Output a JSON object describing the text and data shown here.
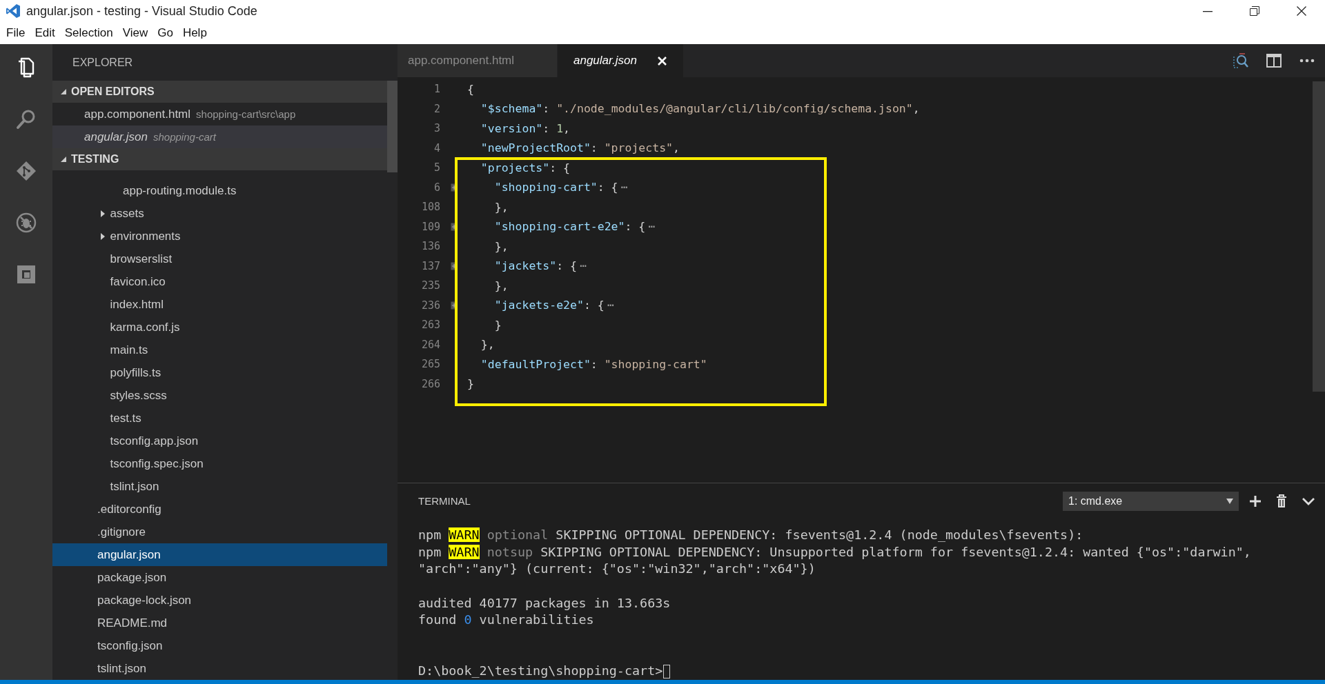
{
  "window": {
    "title": "angular.json - testing - Visual Studio Code"
  },
  "menu": [
    "File",
    "Edit",
    "Selection",
    "View",
    "Go",
    "Help"
  ],
  "activity_bar": [
    {
      "kind": "files",
      "selected": true
    },
    {
      "kind": "search",
      "selected": false
    },
    {
      "kind": "git",
      "selected": false
    },
    {
      "kind": "debug",
      "selected": false
    },
    {
      "kind": "extensions",
      "selected": false
    }
  ],
  "sidebar": {
    "title": "EXPLORER",
    "sections": [
      {
        "title": "OPEN EDITORS",
        "expanded": true,
        "kind": "editors",
        "items": [
          {
            "name": "app.component.html",
            "path": "shopping-cart\\src\\app",
            "selected": false,
            "preview": false
          },
          {
            "name": "angular.json",
            "path": "shopping-cart",
            "selected": true,
            "preview": true
          }
        ]
      },
      {
        "title": "TESTING",
        "expanded": true,
        "kind": "tree",
        "items": [
          {
            "children": [
              {
                "children": [
                  {
                    "label": "app-routing.module.ts",
                    "kind": "file",
                    "selected": false
                  }
                ]
              },
              {
                "label": "assets",
                "kind": "folder",
                "expanded": false,
                "selected": false
              },
              {
                "label": "environments",
                "kind": "folder",
                "expanded": false,
                "selected": false
              },
              {
                "label": "browserslist",
                "kind": "file",
                "selected": false
              },
              {
                "label": "favicon.ico",
                "kind": "file",
                "selected": false
              },
              {
                "label": "index.html",
                "kind": "file",
                "selected": false
              },
              {
                "label": "karma.conf.js",
                "kind": "file",
                "selected": false
              },
              {
                "label": "main.ts",
                "kind": "file",
                "selected": false
              },
              {
                "label": "polyfills.ts",
                "kind": "file",
                "selected": false
              },
              {
                "label": "styles.scss",
                "kind": "file",
                "selected": false
              },
              {
                "label": "test.ts",
                "kind": "file",
                "selected": false
              },
              {
                "label": "tsconfig.app.json",
                "kind": "file",
                "selected": false
              },
              {
                "label": "tsconfig.spec.json",
                "kind": "file",
                "selected": false
              },
              {
                "label": "tslint.json",
                "kind": "file",
                "selected": false
              }
            ]
          },
          {
            "label": ".editorconfig",
            "kind": "file",
            "selected": false
          },
          {
            "label": ".gitignore",
            "kind": "file",
            "selected": false
          },
          {
            "label": "angular.json",
            "kind": "file",
            "selected": true
          },
          {
            "label": "package.json",
            "kind": "file",
            "selected": false
          },
          {
            "label": "package-lock.json",
            "kind": "file",
            "selected": false
          },
          {
            "label": "README.md",
            "kind": "file",
            "selected": false
          },
          {
            "label": "tsconfig.json",
            "kind": "file",
            "selected": false
          },
          {
            "label": "tslint.json",
            "kind": "file",
            "selected": false
          }
        ]
      }
    ]
  },
  "tabs": [
    {
      "label": "app.component.html",
      "selected": false,
      "preview": false
    },
    {
      "label": "angular.json",
      "selected": true,
      "preview": true
    }
  ],
  "code_lines": [
    {
      "number": "1",
      "folded": false,
      "tokens": [
        {
          "kind": "punct",
          "text": "{"
        }
      ]
    },
    {
      "number": "2",
      "folded": false,
      "tokens": [
        {
          "kind": "key",
          "text": "  \"$schema\""
        },
        {
          "kind": "punct",
          "text": ": "
        },
        {
          "kind": "string",
          "text": "\"./node_modules/@angular/cli/lib/config/schema.json\""
        },
        {
          "kind": "punct",
          "text": ","
        }
      ]
    },
    {
      "number": "3",
      "folded": false,
      "tokens": [
        {
          "kind": "key",
          "text": "  \"version\""
        },
        {
          "kind": "punct",
          "text": ": "
        },
        {
          "kind": "number",
          "text": "1"
        },
        {
          "kind": "punct",
          "text": ","
        }
      ]
    },
    {
      "number": "4",
      "folded": false,
      "tokens": [
        {
          "kind": "key",
          "text": "  \"newProjectRoot\""
        },
        {
          "kind": "punct",
          "text": ": "
        },
        {
          "kind": "string",
          "text": "\"projects\""
        },
        {
          "kind": "punct",
          "text": ","
        }
      ]
    },
    {
      "number": "5",
      "folded": false,
      "tokens": [
        {
          "kind": "key",
          "text": "  \"projects\""
        },
        {
          "kind": "punct",
          "text": ": {"
        }
      ]
    },
    {
      "number": "6",
      "folded": true,
      "tokens": [
        {
          "kind": "key",
          "text": "    \"shopping-cart\""
        },
        {
          "kind": "punct",
          "text": ": {"
        },
        {
          "kind": "ellipsis",
          "text": "⋯"
        }
      ]
    },
    {
      "number": "108",
      "folded": false,
      "tokens": [
        {
          "kind": "punct",
          "text": "    },"
        }
      ]
    },
    {
      "number": "109",
      "folded": true,
      "tokens": [
        {
          "kind": "key",
          "text": "    \"shopping-cart-e2e\""
        },
        {
          "kind": "punct",
          "text": ": {"
        },
        {
          "kind": "ellipsis",
          "text": "⋯"
        }
      ]
    },
    {
      "number": "136",
      "folded": false,
      "tokens": [
        {
          "kind": "punct",
          "text": "    },"
        }
      ]
    },
    {
      "number": "137",
      "folded": true,
      "tokens": [
        {
          "kind": "key",
          "text": "    \"jackets\""
        },
        {
          "kind": "punct",
          "text": ": {"
        },
        {
          "kind": "ellipsis",
          "text": "⋯"
        }
      ]
    },
    {
      "number": "235",
      "folded": false,
      "tokens": [
        {
          "kind": "punct",
          "text": "    },"
        }
      ]
    },
    {
      "number": "236",
      "folded": true,
      "tokens": [
        {
          "kind": "key",
          "text": "    \"jackets-e2e\""
        },
        {
          "kind": "punct",
          "text": ": {"
        },
        {
          "kind": "ellipsis",
          "text": "⋯"
        }
      ]
    },
    {
      "number": "263",
      "folded": false,
      "tokens": [
        {
          "kind": "punct",
          "text": "    }"
        }
      ]
    },
    {
      "number": "264",
      "folded": false,
      "tokens": [
        {
          "kind": "punct",
          "text": "  },"
        }
      ]
    },
    {
      "number": "265",
      "folded": false,
      "tokens": [
        {
          "kind": "key",
          "text": "  \"defaultProject\""
        },
        {
          "kind": "punct",
          "text": ": "
        },
        {
          "kind": "string",
          "text": "\"shopping-cart\""
        }
      ]
    },
    {
      "number": "266",
      "folded": false,
      "tokens": [
        {
          "kind": "punct",
          "text": "}"
        }
      ]
    }
  ],
  "terminal": {
    "title": "TERMINAL",
    "selector": "1: cmd.exe",
    "lines": [
      {
        "kind": "text",
        "cursor": false,
        "tokens": [
          {
            "kind": "plain",
            "text": "npm "
          },
          {
            "kind": "warn",
            "text": "WARN"
          },
          {
            "kind": "dim",
            "text": " optional"
          },
          {
            "kind": "plain",
            "text": " SKIPPING OPTIONAL DEPENDENCY: fsevents@1.2.4 (node_modules\\fsevents):"
          }
        ]
      },
      {
        "kind": "text",
        "cursor": false,
        "tokens": [
          {
            "kind": "plain",
            "text": "npm "
          },
          {
            "kind": "warn",
            "text": "WARN"
          },
          {
            "kind": "dim",
            "text": " notsup"
          },
          {
            "kind": "plain",
            "text": " SKIPPING OPTIONAL DEPENDENCY: Unsupported platform for fsevents@1.2.4: wanted {\"os\":\"darwin\","
          }
        ]
      },
      {
        "kind": "text",
        "cursor": false,
        "tokens": [
          {
            "kind": "plain",
            "text": "\"arch\":\"any\"} (current: {\"os\":\"win32\",\"arch\":\"x64\"})"
          }
        ]
      },
      {
        "kind": "blank"
      },
      {
        "kind": "text",
        "cursor": false,
        "tokens": [
          {
            "kind": "plain",
            "text": "audited 40177 packages in 13.663s"
          }
        ]
      },
      {
        "kind": "text",
        "cursor": false,
        "tokens": [
          {
            "kind": "plain",
            "text": "found "
          },
          {
            "kind": "num",
            "text": "0"
          },
          {
            "kind": "plain",
            "text": " vulnerabilities"
          }
        ]
      },
      {
        "kind": "blank"
      },
      {
        "kind": "blank"
      },
      {
        "kind": "text",
        "cursor": true,
        "tokens": [
          {
            "kind": "plain",
            "text": "D:\\book_2\\testing\\shopping-cart>"
          }
        ]
      }
    ]
  }
}
